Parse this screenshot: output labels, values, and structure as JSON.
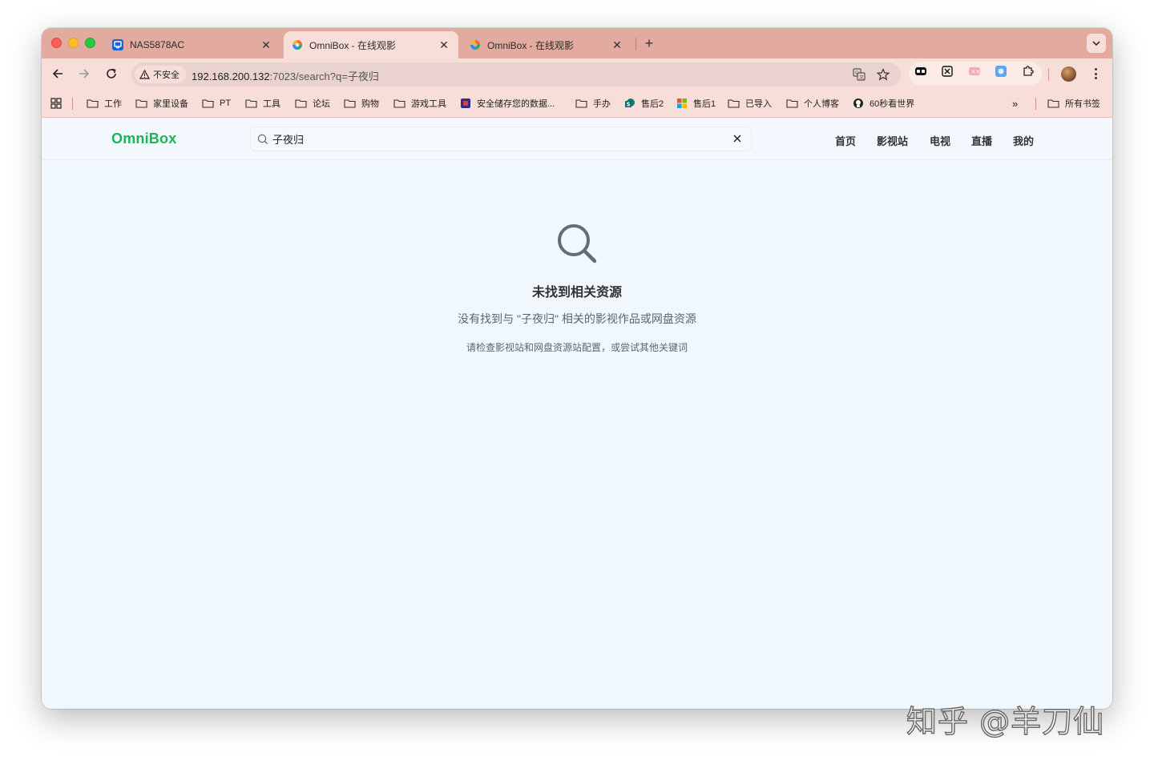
{
  "browser": {
    "tabs": [
      {
        "title": "NAS5878AC",
        "active": false
      },
      {
        "title": "OmniBox - 在线观影",
        "active": true
      },
      {
        "title": "OmniBox - 在线观影",
        "active": false
      }
    ],
    "security_label": "不安全",
    "url_host": "192.168.200.132",
    "url_rest": ":7023/search?q=子夜归",
    "bookmarks": [
      {
        "label": "工作",
        "icon": "folder-icon"
      },
      {
        "label": "家里设备",
        "icon": "folder-icon"
      },
      {
        "label": "PT",
        "icon": "folder-icon"
      },
      {
        "label": "工具",
        "icon": "folder-icon"
      },
      {
        "label": "论坛",
        "icon": "folder-icon"
      },
      {
        "label": "购物",
        "icon": "folder-icon"
      },
      {
        "label": "游戏工具",
        "icon": "folder-icon"
      },
      {
        "label": "安全储存您的数据...",
        "icon": "site-favicon"
      },
      {
        "label": "手办",
        "icon": "folder-icon"
      },
      {
        "label": "售后2",
        "icon": "sharepoint-icon"
      },
      {
        "label": "售后1",
        "icon": "microsoft-icon"
      },
      {
        "label": "已导入",
        "icon": "folder-icon"
      },
      {
        "label": "个人博客",
        "icon": "folder-icon"
      },
      {
        "label": "60秒看世界",
        "icon": "site-favicon"
      }
    ],
    "all_bookmarks_label": "所有书签"
  },
  "app": {
    "brand": "OmniBox",
    "search_value": "子夜归",
    "nav": [
      "首页",
      "影视站",
      "电视",
      "直播",
      "我的"
    ]
  },
  "empty_state": {
    "title": "未找到相关资源",
    "description": "没有找到与 \"子夜归\" 相关的影视作品或网盘资源",
    "hint": "请检查影视站和网盘资源站配置，或尝试其他关键词"
  },
  "watermark": "知乎 @羊刀仙",
  "colors": {
    "tab_strip": "#e3aa9f",
    "toolbar": "#f7ded8",
    "brand_green": "#1fb35a",
    "page_bg": "#f0f7fd"
  }
}
